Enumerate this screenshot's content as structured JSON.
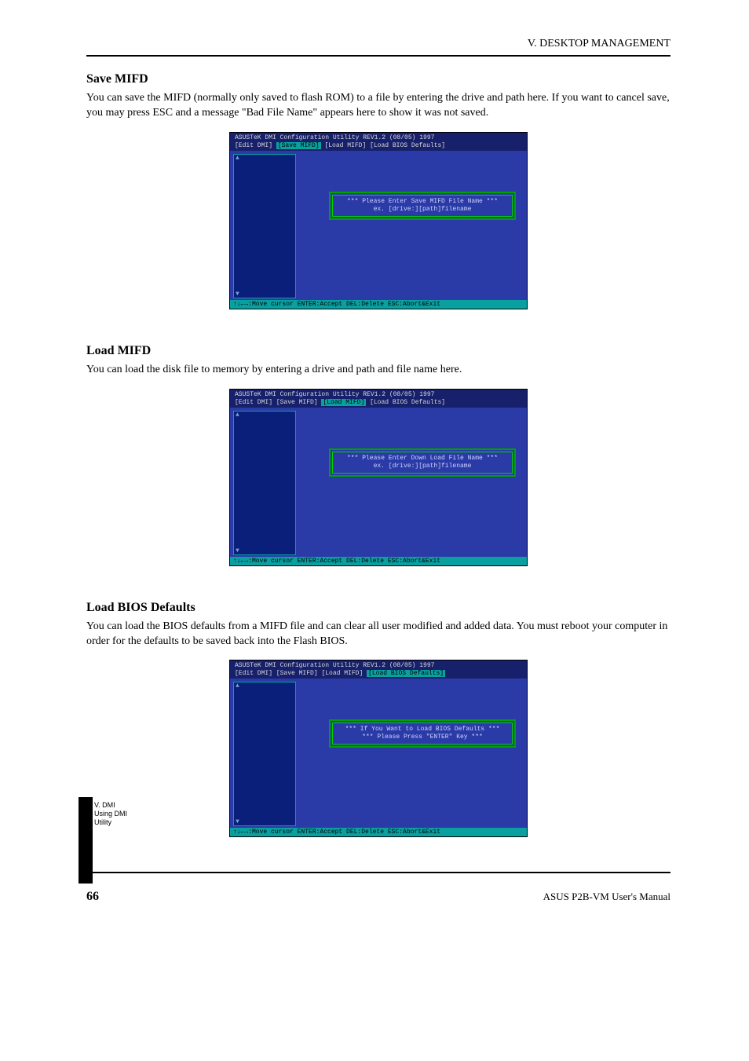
{
  "header": {
    "right": "V. DESKTOP MANAGEMENT"
  },
  "sections": {
    "save": {
      "title": "Save MIFD",
      "body": "You can save the MIFD (normally only saved to flash ROM) to a file by entering the drive and path here. If you want to cancel save, you may press ESC and a message \"Bad File Name\" appears here to show it was not saved."
    },
    "load": {
      "title": "Load MIFD",
      "body": "You can load the disk file to memory by entering a drive and path and file name here."
    },
    "defaults": {
      "title": "Load BIOS Defaults",
      "body": "You can load the BIOS defaults from a MIFD file and can clear all user modified and added data. You must reboot your computer in order for the defaults to be saved back into the Flash BIOS."
    }
  },
  "bios_common": {
    "title": "ASUSTeK DMI Configuration Utility  REV1.2  (08/05)  1997",
    "menu": {
      "edit": "[Edit DMI]",
      "save": "[Save MIFD]",
      "load": "[Load MIFD]",
      "defaults": "[Load BIOS Defaults]"
    },
    "footer": "↑↓←→:Move cursor  ENTER:Accept  DEL:Delete  ESC:Abort&Exit",
    "scroll_up": "▲",
    "scroll_down": "▼"
  },
  "bios_save": {
    "dialog_line1": "*** Please Enter Save MIFD File Name ***",
    "dialog_line2": "ex. [drive:][path]filename"
  },
  "bios_load": {
    "dialog_line1": "*** Please Enter Down Load File Name ***",
    "dialog_line2": "ex. [drive:][path]filename"
  },
  "bios_defaults": {
    "dialog_line1": "*** If You Want to Load BIOS Defaults ***",
    "dialog_line2": "*** Please Press \"ENTER\" Key ***"
  },
  "side_tab": {
    "line1": "V. DMI",
    "line2": "Using DMI Utility"
  },
  "footer": {
    "page": "66",
    "model": "ASUS P2B-VM User's Manual"
  }
}
